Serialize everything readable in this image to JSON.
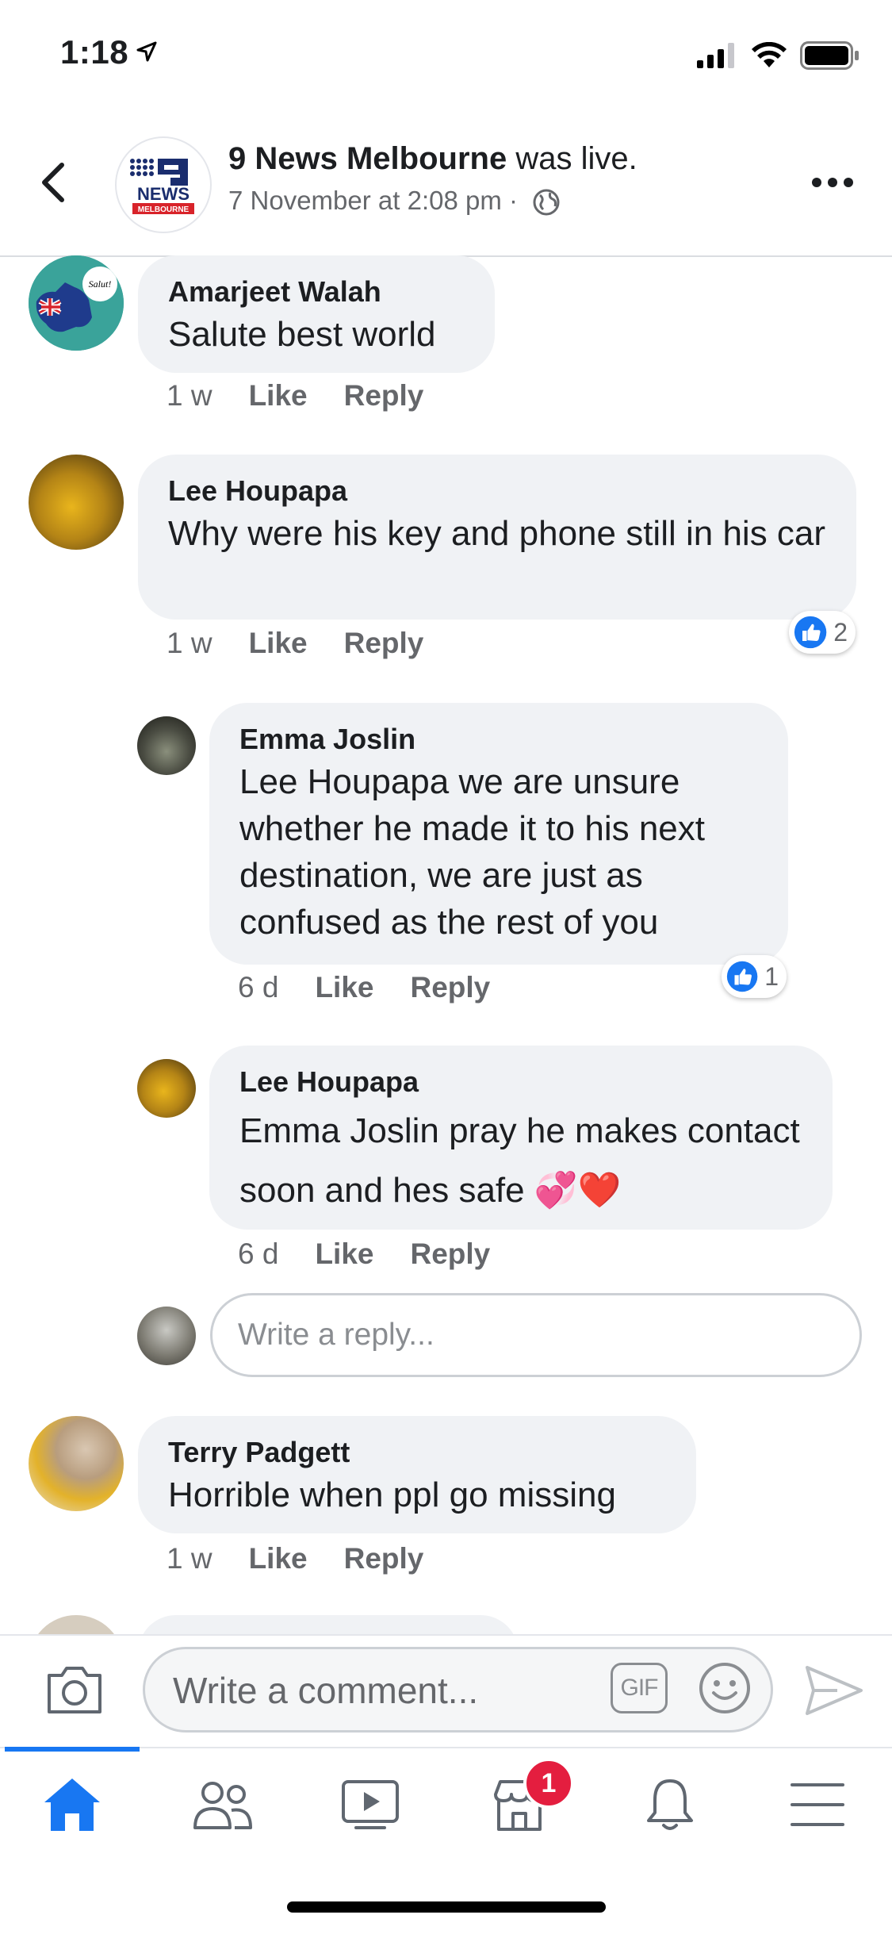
{
  "status_bar": {
    "time": "1:18"
  },
  "header": {
    "page_name": "9 News Melbourne",
    "title_suffix": " was live.",
    "subtitle": "7 November at 2:08 pm ·",
    "logo_text": "NEWS",
    "logo_sub": "MELBOURNE"
  },
  "comments": [
    {
      "name": "Amarjeet Walah",
      "text": "Salute best world",
      "time": "1 w",
      "like": "Like",
      "reply": "Reply",
      "avatar_label": "Salut!"
    },
    {
      "name": "Lee Houpapa",
      "text": "Why were his key and phone still in his car",
      "time": "1 w",
      "like": "Like",
      "reply": "Reply",
      "reactions": "2"
    },
    {
      "name": "Emma Joslin",
      "text": "Lee Houpapa we are unsure whether he made it to his next destination, we are just as confused as the rest of you",
      "time": "6 d",
      "like": "Like",
      "reply": "Reply",
      "reactions": "1"
    },
    {
      "name": "Lee Houpapa",
      "text": "Emma Joslin pray he makes contact soon and hes safe 💞❤️",
      "time": "6 d",
      "like": "Like",
      "reply": "Reply"
    },
    {
      "name": "Terry Padgett",
      "text": "Horrible when ppl go missing",
      "time": "1 w",
      "like": "Like",
      "reply": "Reply"
    }
  ],
  "reply_input": {
    "placeholder": "Write a reply..."
  },
  "composer": {
    "placeholder": "Write a comment...",
    "gif_label": "GIF"
  },
  "tabbar": {
    "tabs": [
      "home-icon",
      "friends-icon",
      "watch-icon",
      "marketplace-icon",
      "notifications-icon",
      "menu-icon"
    ],
    "marketplace_badge": "1"
  },
  "colors": {
    "accent": "#1877f2",
    "badge": "#e41e3f",
    "bubble": "#f0f2f5"
  }
}
